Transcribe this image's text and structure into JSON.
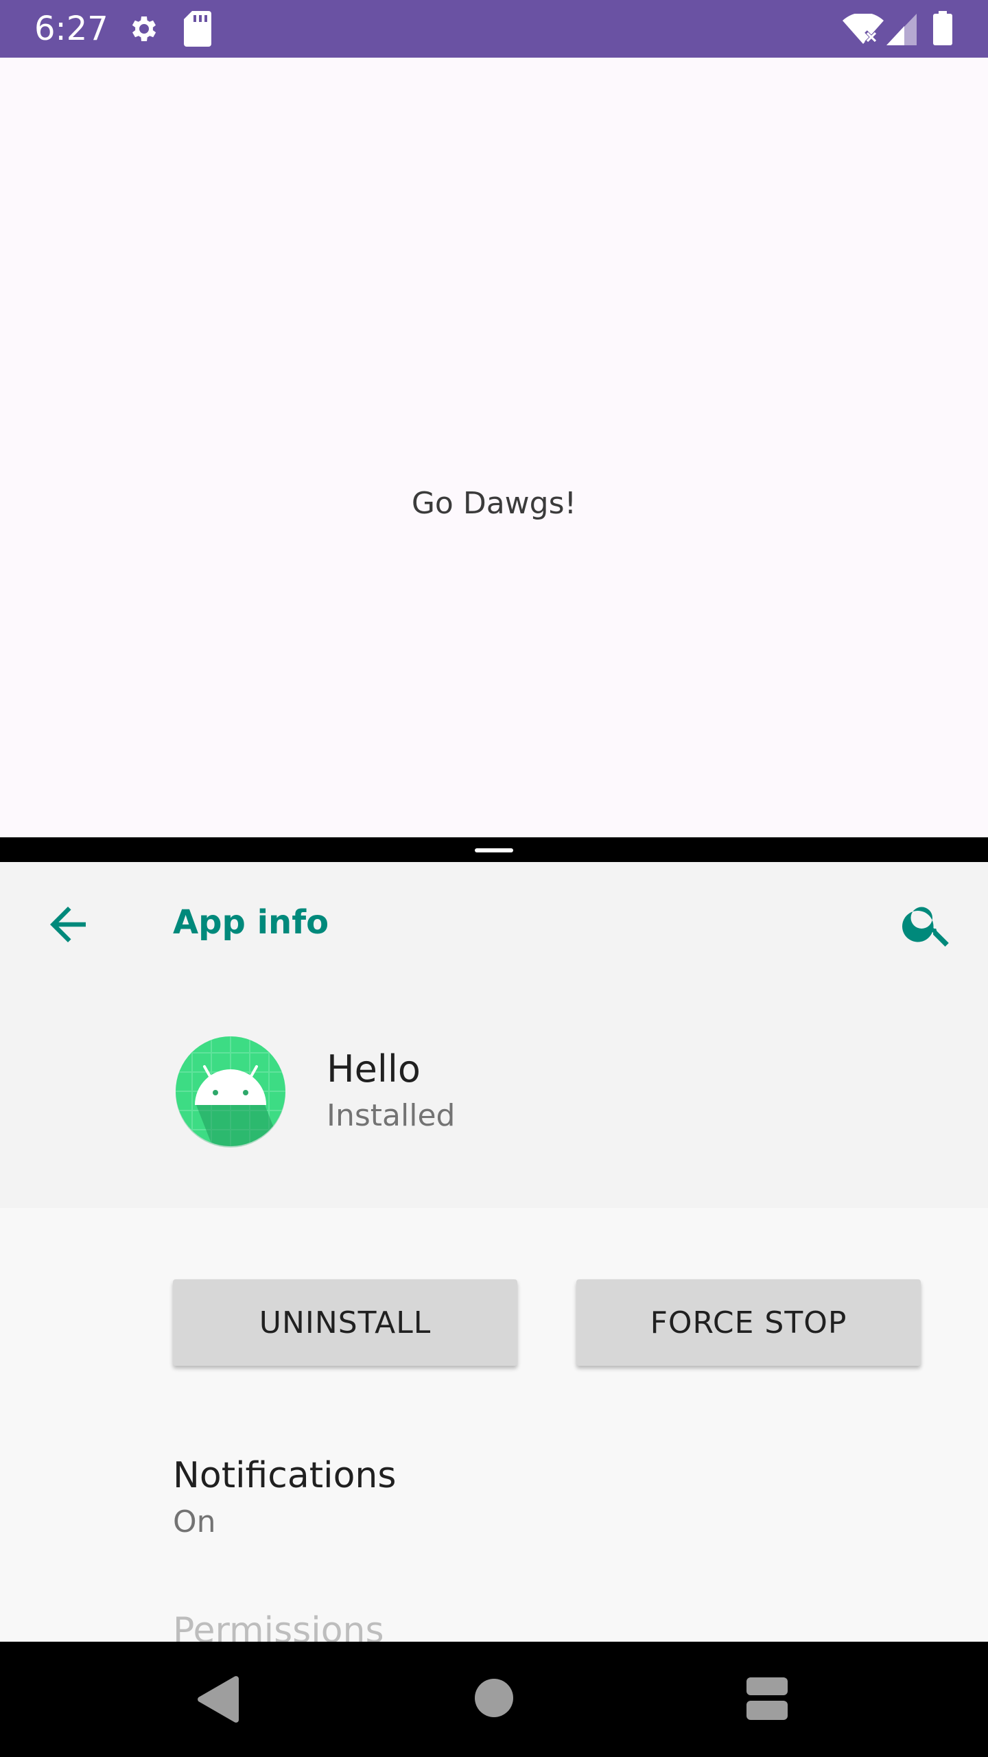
{
  "status_bar": {
    "time": "6:27",
    "background": "#6a52a3",
    "icons": [
      "gear-icon",
      "sd-card-icon",
      "wifi-off-icon",
      "signal-icon",
      "battery-icon"
    ]
  },
  "top_app": {
    "message": "Go Dawgs!"
  },
  "settings": {
    "title": "App info",
    "accent": "#00897b",
    "app": {
      "name": "Hello",
      "status": "Installed"
    },
    "buttons": {
      "uninstall": "UNINSTALL",
      "force_stop": "FORCE STOP"
    },
    "preferences": [
      {
        "title": "Notifications",
        "summary": "On"
      },
      {
        "title": "Permissions"
      }
    ]
  },
  "nav_bar": {
    "icons": [
      "nav-back-icon",
      "nav-home-icon",
      "nav-recents-icon"
    ]
  }
}
